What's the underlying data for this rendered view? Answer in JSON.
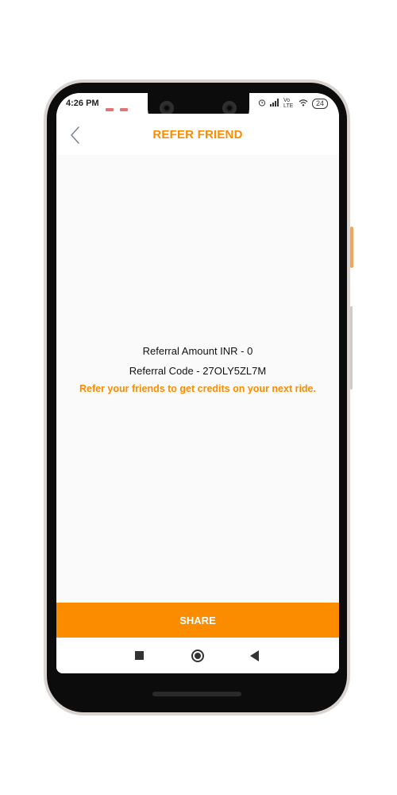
{
  "status_bar": {
    "time": "4:26 PM",
    "network": "Vo LTE",
    "battery": "24",
    "icons": [
      "alarm-icon",
      "signal-icon",
      "wifi-icon",
      "battery-icon"
    ]
  },
  "header": {
    "title": "REFER FRIEND",
    "back_icon": "chevron-left-icon"
  },
  "referral": {
    "amount_text": "Referral Amount INR - 0",
    "code_text": "Referral Code - 27OLY5ZL7M",
    "promo_text": "Refer your friends to get credits on your next ride."
  },
  "actions": {
    "share_label": "SHARE"
  },
  "nav_bar": {
    "icons": [
      "recents-square-icon",
      "home-circle-icon",
      "back-triangle-icon"
    ]
  },
  "colors": {
    "accent": "#fb8c00",
    "screen_bg": "#fafafa",
    "frame": "#0c0c0c"
  }
}
